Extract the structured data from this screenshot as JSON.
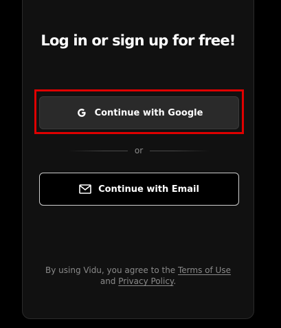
{
  "auth": {
    "title": "Log in or sign up for free!",
    "google_label": "Continue with Google",
    "divider_text": "or",
    "email_label": "Continue with Email",
    "terms": {
      "prefix": "By using Vidu, you agree to the ",
      "terms_link": "Terms of Use",
      "middle": "and ",
      "privacy_link": "Privacy Policy",
      "suffix": "."
    }
  },
  "colors": {
    "background": "#000000",
    "card": "#111111",
    "google_button": "#2a2a2a",
    "highlight": "#e00000",
    "text": "#ffffff",
    "muted_text": "#8a8a8a"
  },
  "icons": {
    "google": "google-g-icon",
    "email": "mail-icon"
  }
}
